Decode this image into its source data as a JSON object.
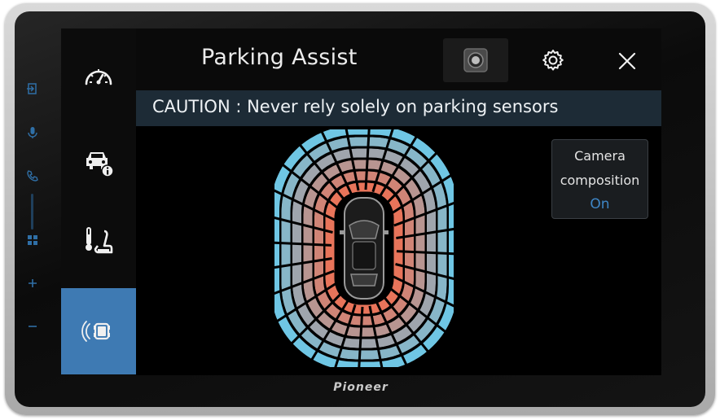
{
  "header": {
    "title": "Parking Assist"
  },
  "caution": {
    "text": "CAUTION : Never rely solely on parking sensors"
  },
  "camera_composition": {
    "line1": "Camera",
    "line2": "composition",
    "value": "On"
  },
  "sidebar": {
    "items": [
      {
        "icon": "speedometer-icon",
        "active": false
      },
      {
        "icon": "car-info-icon",
        "active": false
      },
      {
        "icon": "seat-heater-icon",
        "active": false
      },
      {
        "icon": "parking-sensor-icon",
        "active": true
      }
    ]
  },
  "hardware_buttons": [
    "exit-icon",
    "microphone-icon",
    "phone-icon",
    "apps-grid-icon",
    "volume-up-icon",
    "volume-down-icon"
  ],
  "brand": {
    "logo": "Pioneer"
  },
  "colors": {
    "accent": "#3e7ab3",
    "caution_bar": "#1d2b36",
    "sensor_near": "#e8745a",
    "sensor_far": "#6fc6e4",
    "value_blue": "#3e86c6"
  }
}
